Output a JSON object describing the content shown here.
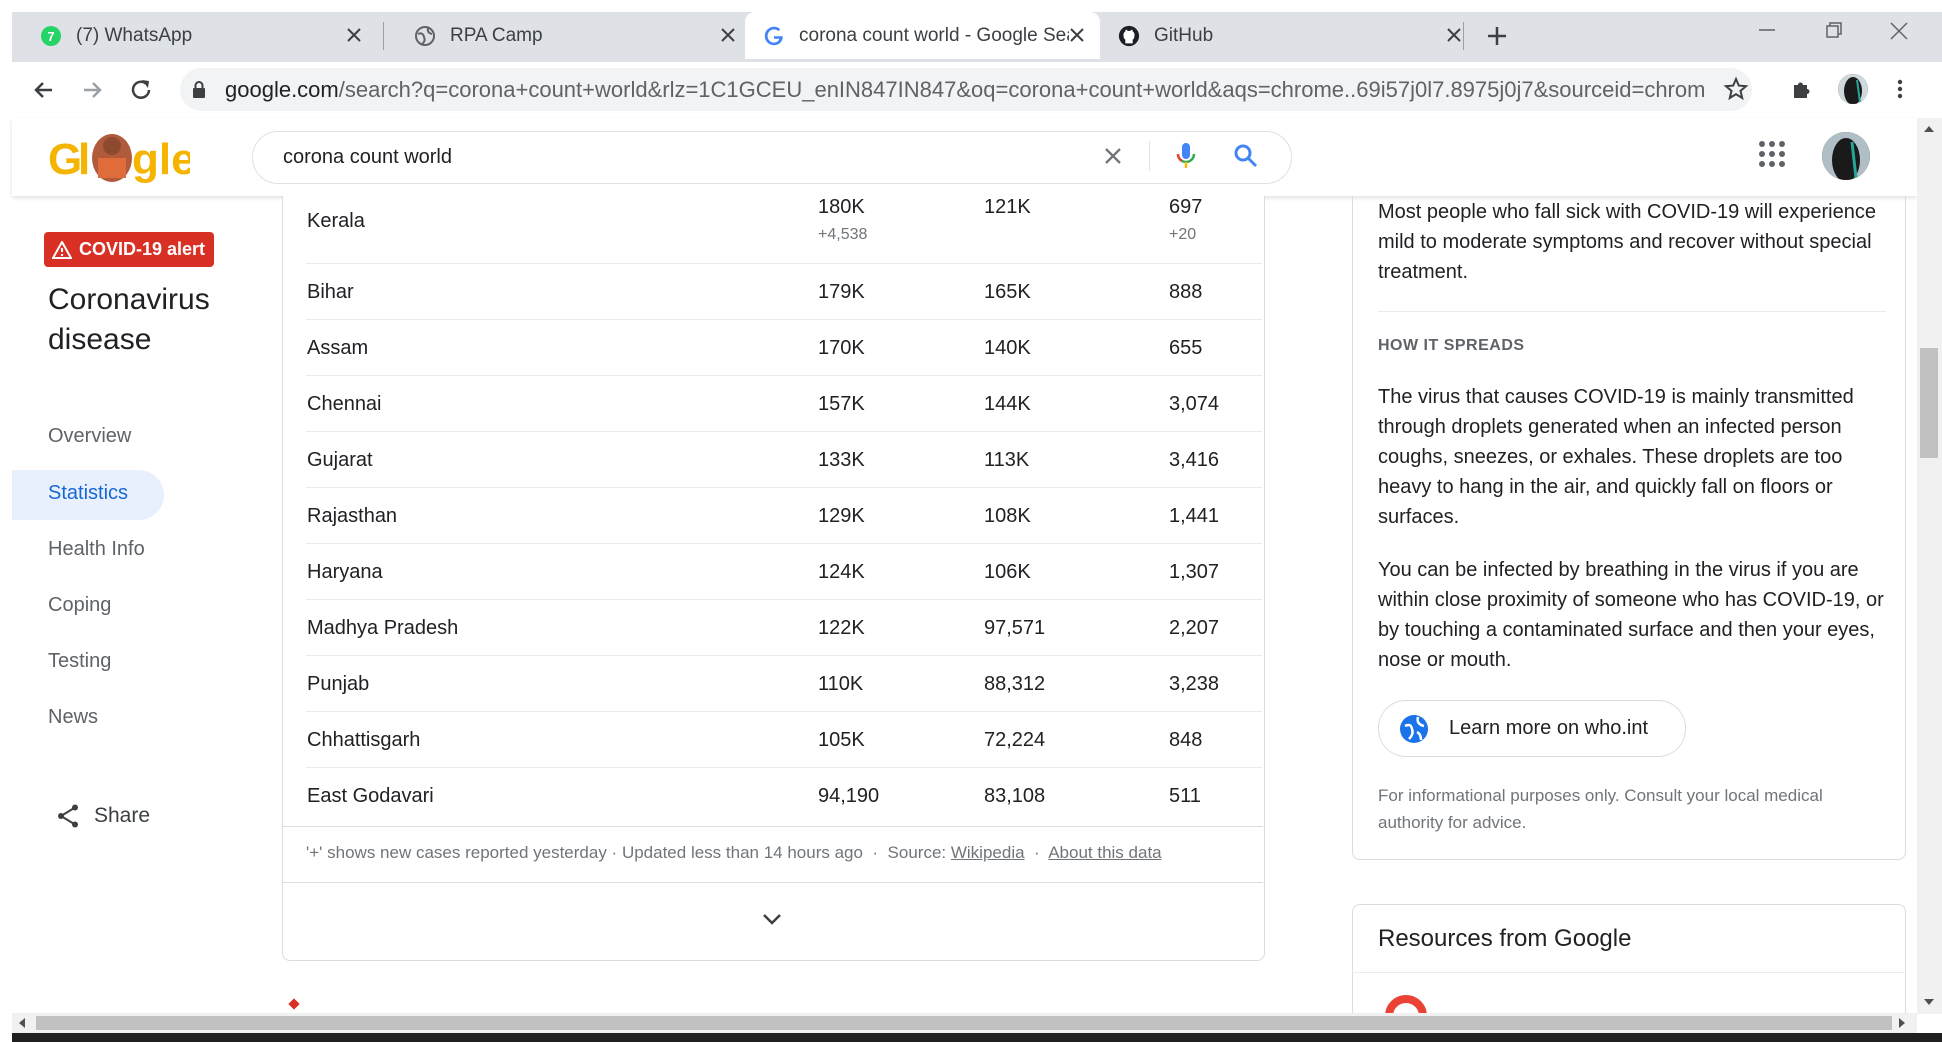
{
  "browser": {
    "tabs": [
      {
        "label": "(7) WhatsApp",
        "icon": "whatsapp-icon"
      },
      {
        "label": "RPA Camp",
        "icon": "globe-icon"
      },
      {
        "label": "corona count world - Google Sea",
        "icon": "google-g-icon",
        "active": true
      },
      {
        "label": "GitHub",
        "icon": "github-icon"
      }
    ],
    "new_tab_symbol": "+",
    "url_host": "google.com",
    "url_path": "/search?q=corona+count+world&rlz=1C1GCEU_enIN847IN847&oq=corona+count+world&aqs=chrome..69i57j0l7.8975j0j7&sourceid=chrome&i..."
  },
  "search": {
    "query": "corona count world"
  },
  "sidebar": {
    "alert_badge": "COVID-19 alert",
    "title": "Coronavirus disease",
    "nav": [
      "Overview",
      "Statistics",
      "Health Info",
      "Coping",
      "Testing",
      "News"
    ],
    "selected": "Statistics",
    "share": "Share"
  },
  "table": {
    "rows": [
      {
        "name": "Kerala",
        "cases": "180K",
        "cases_new": "+4,538",
        "recovered": "121K",
        "deaths": "697",
        "deaths_new": "+20"
      },
      {
        "name": "Bihar",
        "cases": "179K",
        "recovered": "165K",
        "deaths": "888"
      },
      {
        "name": "Assam",
        "cases": "170K",
        "recovered": "140K",
        "deaths": "655"
      },
      {
        "name": "Chennai",
        "cases": "157K",
        "recovered": "144K",
        "deaths": "3,074"
      },
      {
        "name": "Gujarat",
        "cases": "133K",
        "recovered": "113K",
        "deaths": "3,416"
      },
      {
        "name": "Rajasthan",
        "cases": "129K",
        "recovered": "108K",
        "deaths": "1,441"
      },
      {
        "name": "Haryana",
        "cases": "124K",
        "recovered": "106K",
        "deaths": "1,307"
      },
      {
        "name": "Madhya Pradesh",
        "cases": "122K",
        "recovered": "97,571",
        "deaths": "2,207"
      },
      {
        "name": "Punjab",
        "cases": "110K",
        "recovered": "88,312",
        "deaths": "3,238"
      },
      {
        "name": "Chhattisgarh",
        "cases": "105K",
        "recovered": "72,224",
        "deaths": "848"
      },
      {
        "name": "East Godavari",
        "cases": "94,190",
        "recovered": "83,108",
        "deaths": "511"
      }
    ],
    "footnote_text": "'+' shows new cases reported yesterday · Updated less than 14 hours ago",
    "footnote_dot": "·",
    "source_label": "Source:",
    "source_link": "Wikipedia",
    "about_link": "About this data"
  },
  "info": {
    "paragraph_symptoms": "Most people who fall sick with COVID-19 will experience mild to moderate symptoms and recover without special treatment.",
    "spreads_heading": "HOW IT SPREADS",
    "paragraph_spread_1": "The virus that causes COVID-19 is mainly transmitted through droplets generated when an infected person coughs, sneezes, or exhales. These droplets are too heavy to hang in the air, and quickly fall on floors or surfaces.",
    "paragraph_spread_2": "You can be infected by breathing in the virus if you are within close proximity of someone who has COVID-19, or by touching a contaminated surface and then your eyes, nose or mouth.",
    "learn_more": "Learn more on who.int",
    "disclaimer": "For informational purposes only. Consult your local medical authority for advice.",
    "resources_title": "Resources from Google"
  },
  "colors": {
    "alert_red": "#d93025",
    "link_blue": "#1a73e8",
    "nav_selected_bg": "#e8f0fe"
  }
}
